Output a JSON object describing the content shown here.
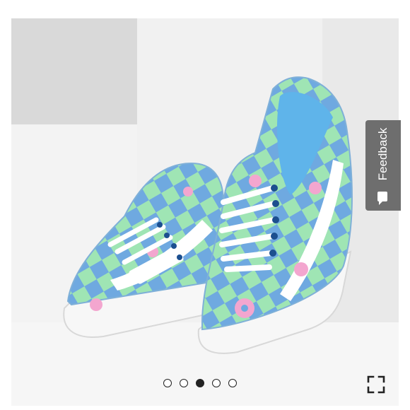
{
  "product_image": {
    "alt": "",
    "colors": {
      "blue": "#6fa9e0",
      "green": "#9fe5b4",
      "pink": "#f3a6cf",
      "white": "#ffffff",
      "sole": "#f7f7f7"
    }
  },
  "feedback": {
    "label": "Feedback",
    "icon": "speech-bubble-icon"
  },
  "carousel": {
    "total": 5,
    "active_index": 2
  },
  "expand": {
    "icon": "fullscreen-icon"
  }
}
